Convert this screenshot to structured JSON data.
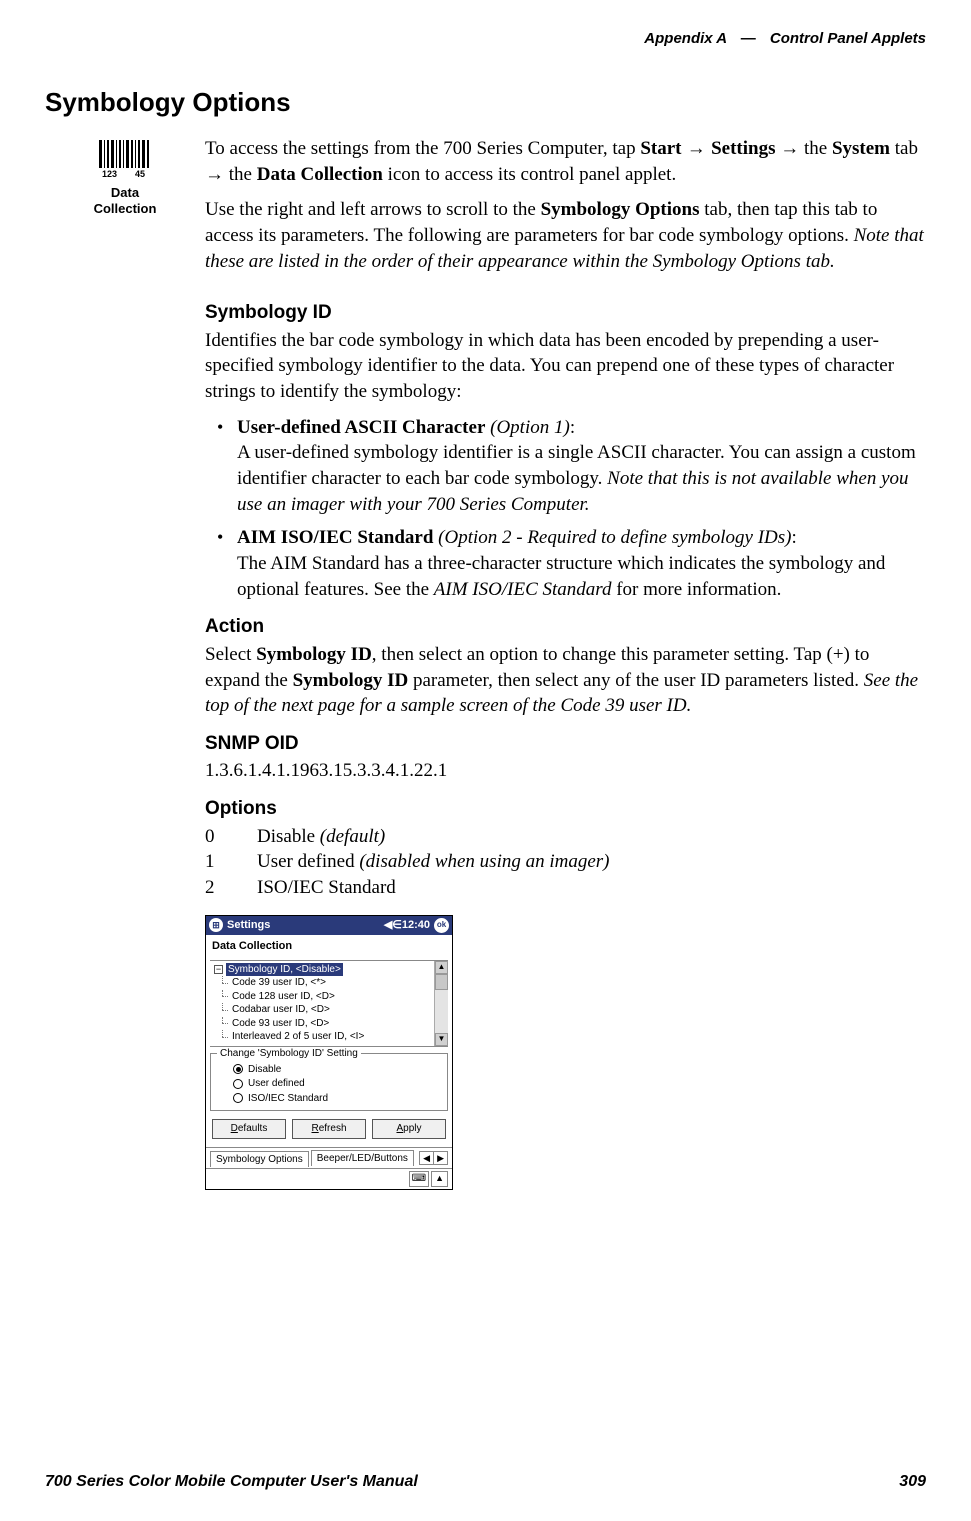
{
  "header": {
    "appendix": "Appendix  A",
    "dash": "—",
    "title": "Control Panel Applets"
  },
  "section_title": "Symbology Options",
  "icon_label_line1": "Data",
  "icon_label_line2": "Collection",
  "para1": {
    "t1": "To access the settings from the 700 Series Computer, tap ",
    "bold1": "Start",
    "arrow": " → ",
    "bold2": "Settings",
    "t2": " → the ",
    "bold3": "System",
    "t3": " tab → the ",
    "bold4": "Data Collection",
    "t4": " icon to access its control panel applet."
  },
  "para2": {
    "t1": "Use the right and left arrows to scroll to the ",
    "bold1": "Symbology Options",
    "t2": " tab, then tap this tab to access its parameters. The following are parameters for bar code symbology options. ",
    "italic1": "Note that these are listed in the order of their appearance within the Symbology Options tab."
  },
  "sub_symid": "Symbology ID",
  "symid_intro": "Identifies the bar code symbology in which data has been encoded by prepending a user-specified symbology identifier to the data. You can prepend one of these types of character strings to identify the symbology:",
  "bullet1": {
    "bold": "User-defined ASCII Character",
    "italic_paren": " (Option 1)",
    "colon": ":",
    "body1": "A user-defined symbology identifier is a single ASCII character. You can assign a custom identifier character to each bar code symbology. ",
    "italic2": "Note that this is not available when you use an imager with your 700 Series Computer."
  },
  "bullet2": {
    "bold": "AIM ISO/IEC Standard",
    "italic_paren": " (Option 2 - Required to define symbology IDs)",
    "colon": ":",
    "body1": "The AIM Standard has a three-character structure which indicates the symbology and optional features. See the ",
    "italic2": "AIM ISO/IEC Standard",
    "body2": " for more information."
  },
  "sub_action": "Action",
  "action_para": {
    "t1": "Select ",
    "bold1": "Symbology ID",
    "t2": ", then select an option to change this parameter setting. Tap (+) to expand the ",
    "bold2": "Symbology ID",
    "t3": " parameter, then select any of the user ID parameters listed. ",
    "italic1": "See the top of the next page for a sample screen of the Code 39 user ID."
  },
  "sub_snmp": "SNMP OID",
  "snmp_value": "1.3.6.1.4.1.1963.15.3.3.4.1.22.1",
  "sub_options": "Options",
  "options_rows": [
    {
      "num": "0",
      "label": "Disable ",
      "italic": "(default)"
    },
    {
      "num": "1",
      "label": "User defined ",
      "italic": "(disabled when using an imager)"
    },
    {
      "num": "2",
      "label": "ISO/IEC Standard",
      "italic": ""
    }
  ],
  "mock": {
    "titlebar": {
      "title": "Settings",
      "time": "12:40",
      "ok": "ok"
    },
    "subtitle": "Data Collection",
    "tree_root": "Symbology ID, <Disable>",
    "tree_children": [
      "Code 39 user ID, <*>",
      "Code 128 user ID, <D>",
      "Codabar user ID, <D>",
      "Code 93 user ID, <D>",
      "Interleaved 2 of 5 user ID, <I>"
    ],
    "group_title": "Change 'Symbology ID' Setting",
    "radios": [
      {
        "label": "Disable",
        "selected": true
      },
      {
        "label": "User defined",
        "selected": false
      },
      {
        "label": "ISO/IEC Standard",
        "selected": false
      }
    ],
    "buttons": {
      "defaults": "Defaults",
      "refresh": "Refresh",
      "apply": "Apply"
    },
    "tabs": {
      "active": "Symbology Options",
      "next": "Beeper/LED/Buttons"
    }
  },
  "footer": {
    "left": "700 Series Color Mobile Computer User's Manual",
    "right": "309"
  }
}
